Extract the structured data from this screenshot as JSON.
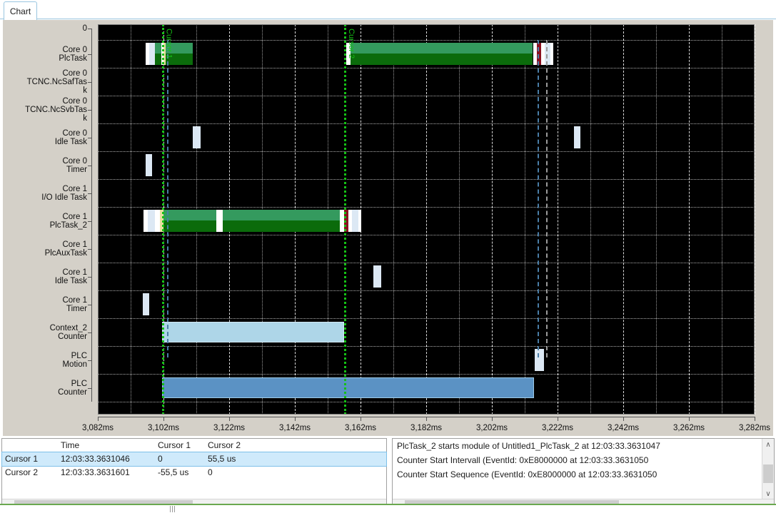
{
  "tab": {
    "label": "Chart"
  },
  "chart_data": {
    "type": "timeline",
    "title": "Chart",
    "xlabel": "",
    "ylabel": "",
    "xlim": [
      3082,
      3282
    ],
    "x_unit": "ms",
    "xticks": [
      "3,082ms",
      "3,102ms",
      "3,122ms",
      "3,142ms",
      "3,162ms",
      "3,182ms",
      "3,202ms",
      "3,222ms",
      "3,242ms",
      "3,262ms",
      "3,282ms"
    ],
    "xtick_values": [
      3082,
      3102,
      3122,
      3142,
      3162,
      3182,
      3202,
      3222,
      3242,
      3262,
      3282
    ],
    "grid": true,
    "legend": "none",
    "background": "#000000",
    "top_tick_label": "0",
    "rows": [
      {
        "label": "Core 0\nPlcTask"
      },
      {
        "label": "Core 0\nTCNC.NcSafTas\nk"
      },
      {
        "label": "Core 0\nTCNC.NcSvbTas\nk"
      },
      {
        "label": "Core 0\nIdle Task"
      },
      {
        "label": "Core 0\nTimer"
      },
      {
        "label": "Core 1\nI/O Idle Task"
      },
      {
        "label": "Core 1\nPlcTask_2"
      },
      {
        "label": "Core 1\nPlcAuxTask"
      },
      {
        "label": "Core 1\nIdle Task"
      },
      {
        "label": "Core 1\nTimer"
      },
      {
        "label": "Context_2\nCounter"
      },
      {
        "label": "PLC\nMotion"
      },
      {
        "label": "PLC\nCounter"
      }
    ],
    "cursors": [
      {
        "name": "Cursor 1",
        "x_ms": 3101.5,
        "color": "#15c115"
      },
      {
        "name": "Cursor 2",
        "x_ms": 3157.0,
        "color": "#15c115"
      }
    ],
    "colors": {
      "green_top": "#349a5e",
      "green_bottom": "#0b6b0b",
      "light_blue": "#aed6e8",
      "mid_blue": "#5b92c4",
      "pale": "#dce8f4",
      "white": "#ffffff",
      "dark_red": "#8a1020",
      "yellow": "#e8e0a0"
    },
    "series": [
      {
        "row": 0,
        "kind": "task",
        "segments": [
          {
            "x0": 3096.5,
            "x1": 3097.6,
            "fill": "white"
          },
          {
            "x0": 3097.6,
            "x1": 3099.4,
            "fill": "pale"
          },
          {
            "x0": 3099.4,
            "x1": 3101.3,
            "fill": "green"
          },
          {
            "x0": 3101.3,
            "x1": 3102.0,
            "fill": "white"
          },
          {
            "x0": 3102.0,
            "x1": 3102.7,
            "fill": "yellow"
          },
          {
            "x0": 3102.7,
            "x1": 3111.0,
            "fill": "green"
          },
          {
            "x0": 3157.6,
            "x1": 3159.0,
            "fill": "white"
          },
          {
            "x0": 3159.0,
            "x1": 3214.5,
            "fill": "green"
          },
          {
            "x0": 3214.5,
            "x1": 3215.6,
            "fill": "white"
          },
          {
            "x0": 3215.6,
            "x1": 3217.0,
            "fill": "dark_red"
          },
          {
            "x0": 3217.0,
            "x1": 3218.0,
            "fill": "white"
          },
          {
            "x0": 3218.0,
            "x1": 3219.8,
            "fill": "pale"
          },
          {
            "x0": 3219.8,
            "x1": 3220.6,
            "fill": "white"
          }
        ]
      },
      {
        "row": 3,
        "kind": "slim",
        "segments": [
          {
            "x0": 3111.0,
            "x1": 3113.4,
            "fill": "pale"
          },
          {
            "x0": 3227.0,
            "x1": 3229.0,
            "fill": "pale"
          }
        ]
      },
      {
        "row": 4,
        "kind": "slim",
        "segments": [
          {
            "x0": 3096.6,
            "x1": 3098.6,
            "fill": "pale"
          }
        ]
      },
      {
        "row": 6,
        "kind": "task",
        "segments": [
          {
            "x0": 3096.0,
            "x1": 3097.3,
            "fill": "white"
          },
          {
            "x0": 3097.3,
            "x1": 3099.3,
            "fill": "pale"
          },
          {
            "x0": 3099.3,
            "x1": 3101.0,
            "fill": "white"
          },
          {
            "x0": 3101.0,
            "x1": 3102.1,
            "fill": "yellow"
          },
          {
            "x0": 3102.1,
            "x1": 3118.0,
            "fill": "green"
          },
          {
            "x0": 3118.0,
            "x1": 3120.0,
            "fill": "white"
          },
          {
            "x0": 3120.0,
            "x1": 3155.8,
            "fill": "green"
          },
          {
            "x0": 3155.8,
            "x1": 3157.0,
            "fill": "white"
          },
          {
            "x0": 3157.0,
            "x1": 3158.2,
            "fill": "dark_red"
          },
          {
            "x0": 3158.2,
            "x1": 3159.4,
            "fill": "white"
          },
          {
            "x0": 3159.4,
            "x1": 3161.3,
            "fill": "pale"
          },
          {
            "x0": 3161.3,
            "x1": 3162.2,
            "fill": "white"
          }
        ]
      },
      {
        "row": 8,
        "kind": "slim",
        "segments": [
          {
            "x0": 3166.0,
            "x1": 3168.2,
            "fill": "pale"
          }
        ]
      },
      {
        "row": 9,
        "kind": "slim",
        "segments": [
          {
            "x0": 3095.8,
            "x1": 3097.6,
            "fill": "pale"
          }
        ]
      },
      {
        "row": 10,
        "kind": "counter",
        "segments": [
          {
            "x0": 3101.5,
            "x1": 3157.0,
            "fill": "light_blue"
          }
        ]
      },
      {
        "row": 11,
        "kind": "slim",
        "segments": [
          {
            "x0": 3215.0,
            "x1": 3217.8,
            "fill": "pale"
          }
        ]
      },
      {
        "row": 12,
        "kind": "counter",
        "segments": [
          {
            "x0": 3101.6,
            "x1": 3214.8,
            "fill": "mid_blue"
          }
        ]
      }
    ],
    "markers": [
      {
        "x_ms": 3103.0,
        "color": "#4a7ea8"
      },
      {
        "x_ms": 3216.0,
        "color": "#4a7ea8"
      },
      {
        "x_ms": 3218.5,
        "color": "#9b9b9b"
      }
    ]
  },
  "cursor_table": {
    "columns": [
      "",
      "Time",
      "Cursor 1",
      "Cursor 2"
    ],
    "rows": [
      {
        "name": "Cursor 1",
        "time": "12:03:33.3631046",
        "cursor1": "0",
        "cursor2": "55,5 us",
        "selected": true
      },
      {
        "name": "Cursor 2",
        "time": "12:03:33.3631601",
        "cursor1": "-55,5 us",
        "cursor2": "0",
        "selected": false
      }
    ]
  },
  "log": {
    "lines": [
      "PlcTask_2 starts module of Untitled1_PlcTask_2 at 12:03:33.3631047",
      "Counter Start Intervall (EventId: 0xE8000000 at 12:03:33.3631050",
      "Counter Start Sequence (EventId: 0xE8000000 at 12:03:33.3631050"
    ]
  },
  "scroll": {
    "left_arrow": "‹",
    "right_arrow": "›",
    "up_arrow": "∧",
    "down_arrow": "∨"
  }
}
